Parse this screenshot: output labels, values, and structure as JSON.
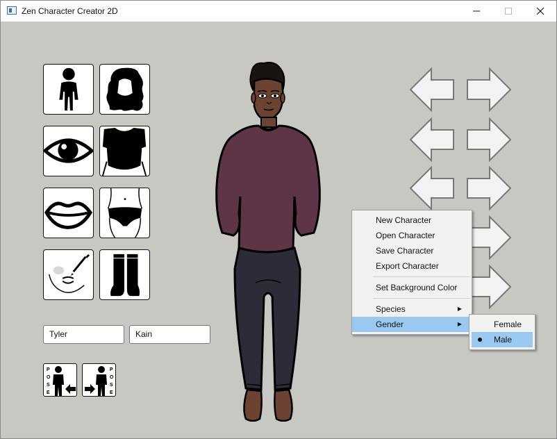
{
  "window": {
    "title": "Zen Character Creator 2D",
    "controls": [
      "minimize",
      "maximize",
      "close"
    ]
  },
  "parts_panel": {
    "tiles": [
      {
        "name": "body-type",
        "icon": "body-icon"
      },
      {
        "name": "hair",
        "icon": "hair-icon"
      },
      {
        "name": "eyes",
        "icon": "eye-icon"
      },
      {
        "name": "top",
        "icon": "shirt-icon"
      },
      {
        "name": "lips",
        "icon": "lips-icon"
      },
      {
        "name": "underwear",
        "icon": "underwear-icon"
      },
      {
        "name": "makeup",
        "icon": "makeup-brush-icon"
      },
      {
        "name": "legwear",
        "icon": "boots-icon"
      }
    ]
  },
  "name_fields": {
    "first_name": "Tyler",
    "last_name": "Kain"
  },
  "pose_buttons": {
    "letters": [
      "P",
      "O",
      "S",
      "E"
    ]
  },
  "context_menu": {
    "items": [
      {
        "label": "New Character"
      },
      {
        "label": "Open Character"
      },
      {
        "label": "Save Character"
      },
      {
        "label": "Export Character"
      },
      {
        "label": "Set Background Color"
      },
      {
        "label": "Species"
      },
      {
        "label": "Gender"
      }
    ],
    "active": "Gender"
  },
  "gender_submenu": {
    "options": [
      "Female",
      "Male"
    ],
    "selected": "Male"
  },
  "colors": {
    "background": "#c8c8c2",
    "menu_highlight": "#99c9f1",
    "skin": "#6b4330",
    "shirt": "#5d3547",
    "pants": "#2b2c38"
  }
}
